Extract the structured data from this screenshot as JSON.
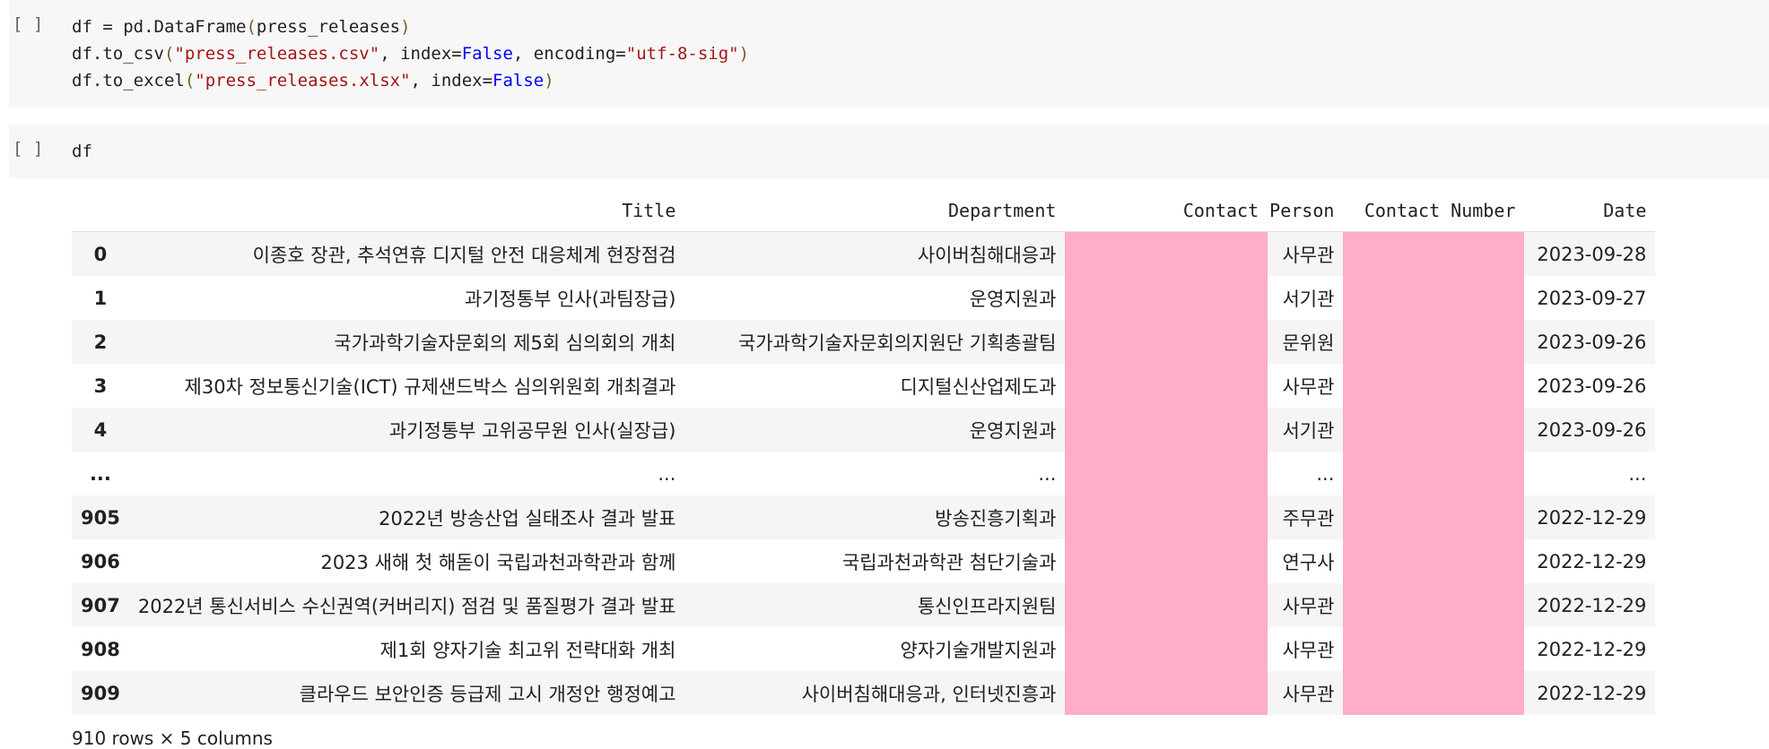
{
  "cells": [
    {
      "run_label": "[ ]",
      "lines": [
        [
          [
            "t",
            "df = pd.DataFrame"
          ],
          [
            "p",
            "("
          ],
          [
            "t",
            "press_releases"
          ],
          [
            "p",
            ")"
          ]
        ],
        [
          [
            "t",
            "df.to_csv"
          ],
          [
            "p",
            "("
          ],
          [
            "s",
            "\"press_releases.csv\""
          ],
          [
            "t",
            ", index="
          ],
          [
            "k",
            "False"
          ],
          [
            "t",
            ", encoding="
          ],
          [
            "s",
            "\"utf-8-sig\""
          ],
          [
            "p",
            ")"
          ]
        ],
        [
          [
            "t",
            "df.to_excel"
          ],
          [
            "p",
            "("
          ],
          [
            "s",
            "\"press_releases.xlsx\""
          ],
          [
            "t",
            ", index="
          ],
          [
            "k",
            "False"
          ],
          [
            "p",
            ")"
          ]
        ]
      ]
    },
    {
      "run_label": "[ ]",
      "lines": [
        [
          [
            "t",
            "df"
          ]
        ]
      ]
    }
  ],
  "table": {
    "columns": [
      "",
      "Title",
      "Department",
      "Contact Person",
      "Contact Number",
      "Date"
    ],
    "rows": [
      {
        "index": "0",
        "title": "이종호 장관, 추석연휴 디지털 안전 대응체계 현장점검",
        "dept": "사이버침해대응과",
        "person": "사무관",
        "date": "2023-09-28"
      },
      {
        "index": "1",
        "title": "과기정통부 인사(과팀장급)",
        "dept": "운영지원과",
        "person": "서기관",
        "date": "2023-09-27"
      },
      {
        "index": "2",
        "title": "국가과학기술자문회의 제5회 심의회의 개최",
        "dept": "국가과학기술자문회의지원단 기획총괄팀",
        "person": "문위원",
        "date": "2023-09-26"
      },
      {
        "index": "3",
        "title": "제30차 정보통신기술(ICT) 규제샌드박스 심의위원회 개최결과",
        "dept": "디지털신산업제도과",
        "person": "사무관",
        "date": "2023-09-26"
      },
      {
        "index": "4",
        "title": "과기정통부 고위공무원 인사(실장급)",
        "dept": "운영지원과",
        "person": "서기관",
        "date": "2023-09-26"
      },
      {
        "index": "...",
        "title": "...",
        "dept": "...",
        "person": "...",
        "date": "..."
      },
      {
        "index": "905",
        "title": "2022년 방송산업 실태조사 결과 발표",
        "dept": "방송진흥기획과",
        "person": "주무관",
        "date": "2022-12-29"
      },
      {
        "index": "906",
        "title": "2023 새해 첫 해돋이 국립과천과학관과 함께",
        "dept": "국립과천과학관 첨단기술과",
        "person": "연구사",
        "date": "2022-12-29"
      },
      {
        "index": "907",
        "title": "2022년 통신서비스 수신권역(커버리지) 점검 및 품질평가 결과 발표",
        "dept": "통신인프라지원팀",
        "person": "사무관",
        "date": "2022-12-29"
      },
      {
        "index": "908",
        "title": "제1회 양자기술 최고위 전략대화 개최",
        "dept": "양자기술개발지원과",
        "person": "사무관",
        "date": "2022-12-29"
      },
      {
        "index": "909",
        "title": "클라우드 보안인증 등급제 고시 개정안 행정예고",
        "dept": "사이버침해대응과, 인터넷진흥과",
        "person": "사무관",
        "date": "2022-12-29"
      }
    ],
    "footer": "910 rows × 5 columns"
  },
  "colors": {
    "redaction": "#ffadc9",
    "cell_bg": "#f7f7f7",
    "string": "#a31515",
    "keyword": "#0000ff"
  }
}
